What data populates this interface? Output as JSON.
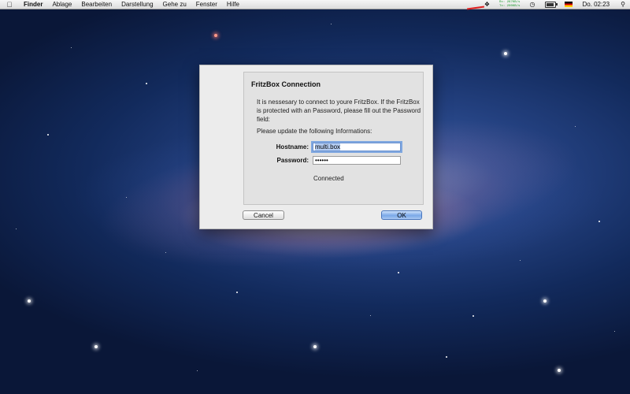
{
  "menubar": {
    "apple_icon": "apple-logo-icon",
    "app_name": "Finder",
    "items": [
      "Ablage",
      "Bearbeiten",
      "Darstellung",
      "Gehe zu",
      "Fenster",
      "Hilfe"
    ],
    "netspeed": {
      "rx_label": "Rx:",
      "rx_value": "267KB/s",
      "tx_label": "Tx:",
      "tx_value": "200KB/s"
    },
    "clock": "Do. 02:23",
    "icons": [
      "dropbox-icon",
      "time-machine-icon",
      "battery-icon",
      "flag-germany-icon",
      "spotlight-search-icon"
    ]
  },
  "dialog": {
    "title": "FritzBox Connection",
    "description": "It is nessesary to connect to youre FritzBox. If the FritzBox is protected with an Password, please fill out the Password field:",
    "prompt": "Please update the following Informations:",
    "hostname_label": "Hostname:",
    "hostname_value": "multi.box",
    "password_label": "Password:",
    "password_value": "••••••",
    "status": "Connected",
    "cancel_label": "Cancel",
    "ok_label": "OK"
  }
}
